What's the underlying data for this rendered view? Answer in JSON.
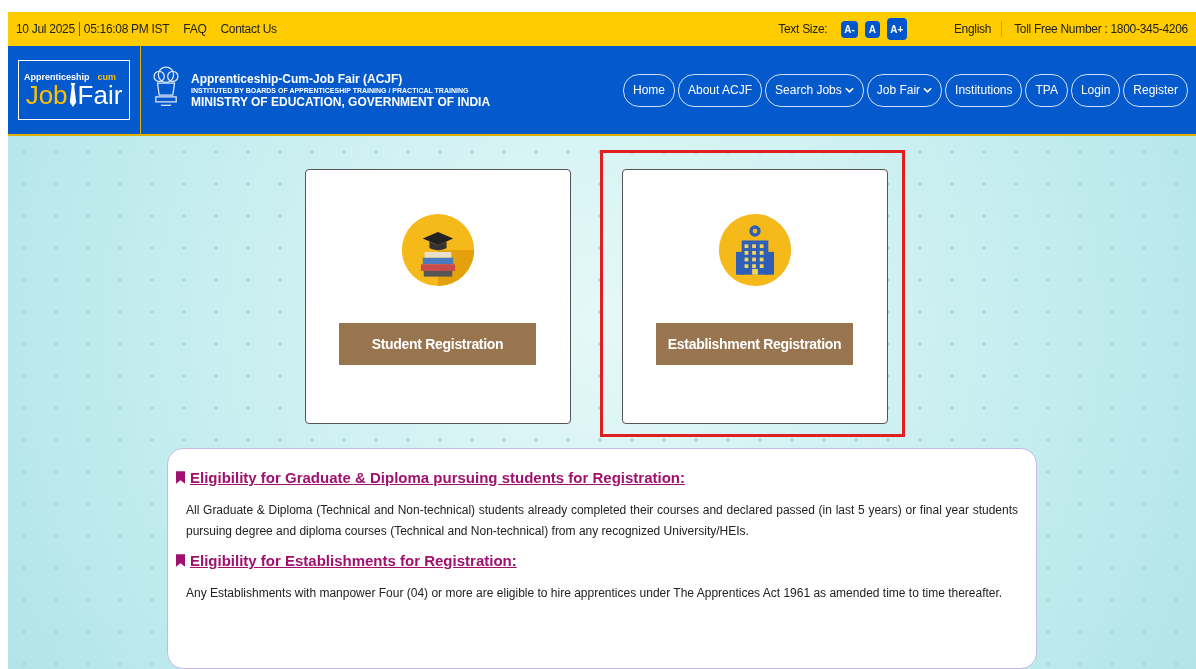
{
  "top_bar": {
    "date": "10 Jul 2025",
    "time": "05:16:08 PM IST",
    "links": [
      "FAQ",
      "Contact Us"
    ],
    "text_size_label": "Text Size:",
    "text_size_buttons": [
      "A-",
      "A",
      "A+"
    ],
    "language": "English",
    "toll_free": "Toll Free Number : 1800-345-4206"
  },
  "header": {
    "logo": {
      "top": "Apprenticeship",
      "cum": "cum",
      "main_1": "Job",
      "main_2": "Fair"
    },
    "title": "Apprenticeship-Cum-Job Fair (ACJF)",
    "subtitle": "INSTITUTED BY BOARDS OF APPRENTICESHIP TRAINING / PRACTICAL TRAINING",
    "ministry": "MINISTRY OF EDUCATION, GOVERNMENT OF INDIA",
    "nav": [
      {
        "label": "Home",
        "dropdown": false
      },
      {
        "label": "About ACJF",
        "dropdown": false
      },
      {
        "label": "Search Jobs",
        "dropdown": true
      },
      {
        "label": "Job Fair",
        "dropdown": true
      },
      {
        "label": "Institutions",
        "dropdown": false
      },
      {
        "label": "TPA",
        "dropdown": false
      },
      {
        "label": "Login",
        "dropdown": false
      },
      {
        "label": "Register",
        "dropdown": false
      }
    ]
  },
  "cards": [
    {
      "kind": "student",
      "button": "Student Registration",
      "highlighted": false
    },
    {
      "kind": "establishment",
      "button": "Establishment Registration",
      "highlighted": true
    }
  ],
  "eligibility": [
    {
      "heading": "Eligibility for Graduate & Diploma pursuing students for Registration:",
      "text": "All Graduate & Diploma (Technical and Non-technical) students already completed their courses and declared passed (in last 5 years) or final year students pursuing degree and diploma courses (Technical and Non-technical) from any recognized University/HEIs."
    },
    {
      "heading": "Eligibility for Establishments for Registration:",
      "text": "Any Establishments with manpower Four (04) or more are eligible to hire apprentices under The Apprentices Act 1961 as amended time to time thereafter."
    }
  ]
}
